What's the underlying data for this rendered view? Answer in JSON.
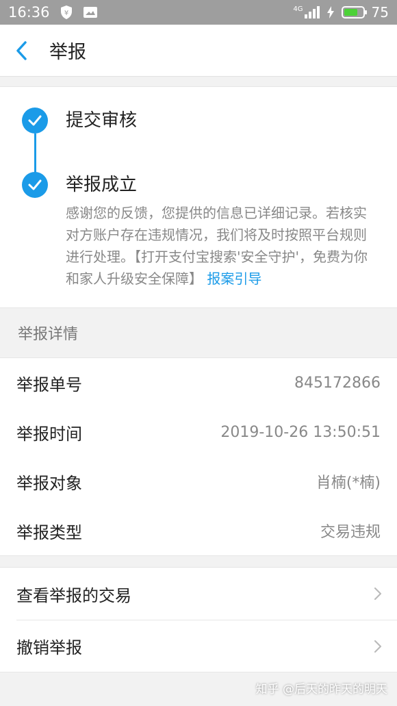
{
  "status_bar": {
    "time": "16:36",
    "network": "4G",
    "battery": "75",
    "battery_level": 0.75
  },
  "nav": {
    "title": "举报"
  },
  "progress": {
    "steps": [
      {
        "title": "提交审核"
      },
      {
        "title": "举报成立",
        "description": "感谢您的反馈，您提供的信息已详细记录。若核实对方账户存在违规情况，我们将及时按照平台规则进行处理。【打开支付宝搜索'安全守护'，免费为你和家人升级安全保障】",
        "link": "报案引导"
      }
    ]
  },
  "details": {
    "header": "举报详情",
    "rows": [
      {
        "label": "举报单号",
        "value": "845172866"
      },
      {
        "label": "举报时间",
        "value": "2019-10-26 13:50:51"
      },
      {
        "label": "举报对象",
        "value": "肖楠(*楠)"
      },
      {
        "label": "举报类型",
        "value": "交易违规"
      }
    ]
  },
  "actions": [
    {
      "label": "查看举报的交易"
    },
    {
      "label": "撤销举报"
    }
  ],
  "watermark": "知乎 @后天的昨天的明天",
  "colors": {
    "accent": "#1b9be8",
    "status_bar": "#9e9e9e",
    "battery": "#4cd137"
  }
}
